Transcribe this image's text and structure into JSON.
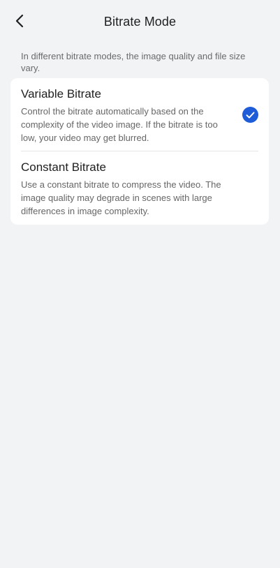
{
  "header": {
    "title": "Bitrate Mode",
    "back_icon": "chevron-left-icon"
  },
  "description": "In different bitrate modes, the image quality and file size vary.",
  "options": [
    {
      "title": "Variable Bitrate",
      "description": "Control the bitrate automatically based on the complexity of the video image. If the bitrate is too low, your video may get blurred.",
      "selected": true,
      "check_icon": "checkmark-circle-icon"
    },
    {
      "title": "Constant Bitrate",
      "description": "Use a constant bitrate to compress the video. The image quality may degrade in scenes with large differences in image complexity.",
      "selected": false
    }
  ],
  "colors": {
    "accent": "#1e5dd7",
    "background": "#f2f3f5",
    "card": "#ffffff"
  }
}
